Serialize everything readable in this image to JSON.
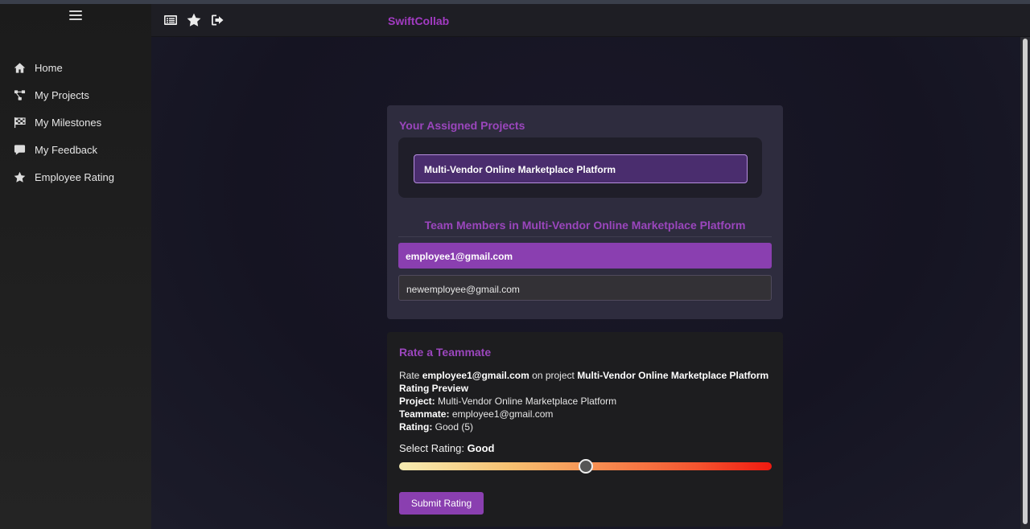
{
  "app": {
    "brand": "SwiftCollab"
  },
  "sidebar": {
    "items": [
      {
        "label": "Home",
        "icon": "home-icon"
      },
      {
        "label": "My Projects",
        "icon": "project-diagram-icon"
      },
      {
        "label": "My Milestones",
        "icon": "checkered-flag-icon"
      },
      {
        "label": "My Feedback",
        "icon": "comment-icon"
      },
      {
        "label": "Employee Rating",
        "icon": "star-icon"
      }
    ]
  },
  "topbar": {
    "icons": [
      "list-icon",
      "star-icon",
      "logout-icon"
    ]
  },
  "assigned": {
    "title": "Your Assigned Projects",
    "projects": [
      "Multi-Vendor Online Marketplace Platform"
    ]
  },
  "team": {
    "title": "Team Members in Multi-Vendor Online Marketplace Platform",
    "members": [
      "employee1@gmail.com",
      "newemployee@gmail.com"
    ]
  },
  "rating": {
    "title": "Rate a Teammate",
    "rate_prefix": "Rate",
    "rate_email": "employee1@gmail.com",
    "rate_mid": "on project",
    "rate_project": "Multi-Vendor Online Marketplace Platform",
    "preview_title": "Rating Preview",
    "project_label": "Project:",
    "project_value": "Multi-Vendor Online Marketplace Platform",
    "teammate_label": "Teammate:",
    "teammate_value": "employee1@gmail.com",
    "rating_label": "Rating:",
    "rating_value": "Good (5)",
    "select_label": "Select Rating:",
    "select_value": "Good",
    "slider_fraction": 0.5,
    "submit_label": "Submit Rating"
  },
  "colors": {
    "accent": "#8a3fb0",
    "brand": "#a23bc2"
  }
}
